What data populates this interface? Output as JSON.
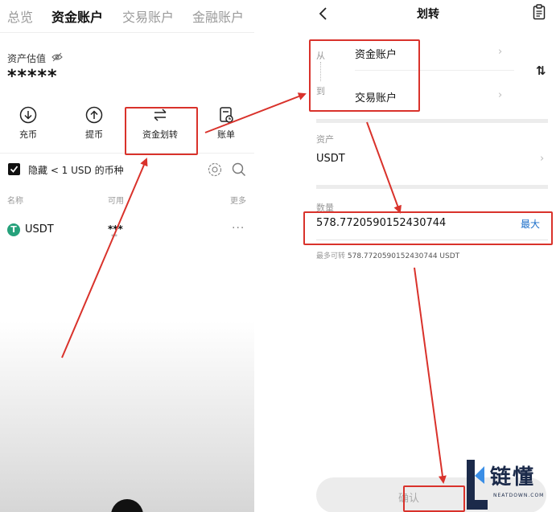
{
  "left_screen": {
    "tabs": [
      "总览",
      "资金账户",
      "交易账户",
      "金融账户"
    ],
    "active_tab": 1,
    "asset_estimate_label": "资产估值",
    "balance_masked": "*****",
    "actions": [
      {
        "label": "充币",
        "icon": "download-icon"
      },
      {
        "label": "提币",
        "icon": "upload-icon"
      },
      {
        "label": "资金划转",
        "icon": "transfer-arrows-icon"
      },
      {
        "label": "账单",
        "icon": "bill-icon"
      }
    ],
    "hide_small_label": "隐藏 < 1 USD 的币种",
    "hide_small_checked": true,
    "columns": {
      "name": "名称",
      "available": "可用",
      "more": "更多"
    },
    "coins": [
      {
        "symbol": "USDT",
        "icon_letter": "T",
        "available": "***",
        "available_sub": "**",
        "more": "···"
      }
    ]
  },
  "right_screen": {
    "title": "划转",
    "from_label": "从",
    "to_label": "到",
    "from_account": "资金账户",
    "to_account": "交易账户",
    "swap_glyph": "⇅",
    "asset_label": "资产",
    "asset_value": "USDT",
    "quantity_label": "数量",
    "quantity_value": "578.7720590152430744",
    "max_button": "最大",
    "max_transferable_label": "最多可转",
    "max_transferable_value": "578.7720590152430744 USDT",
    "confirm_button": "确认"
  },
  "watermark": {
    "brand_cn": "链懂",
    "brand_en": "NEATDOWN.COM"
  },
  "colors": {
    "annotation_red": "#d9322b",
    "tether_green": "#26a17b",
    "link_blue": "#1b6ec9"
  }
}
